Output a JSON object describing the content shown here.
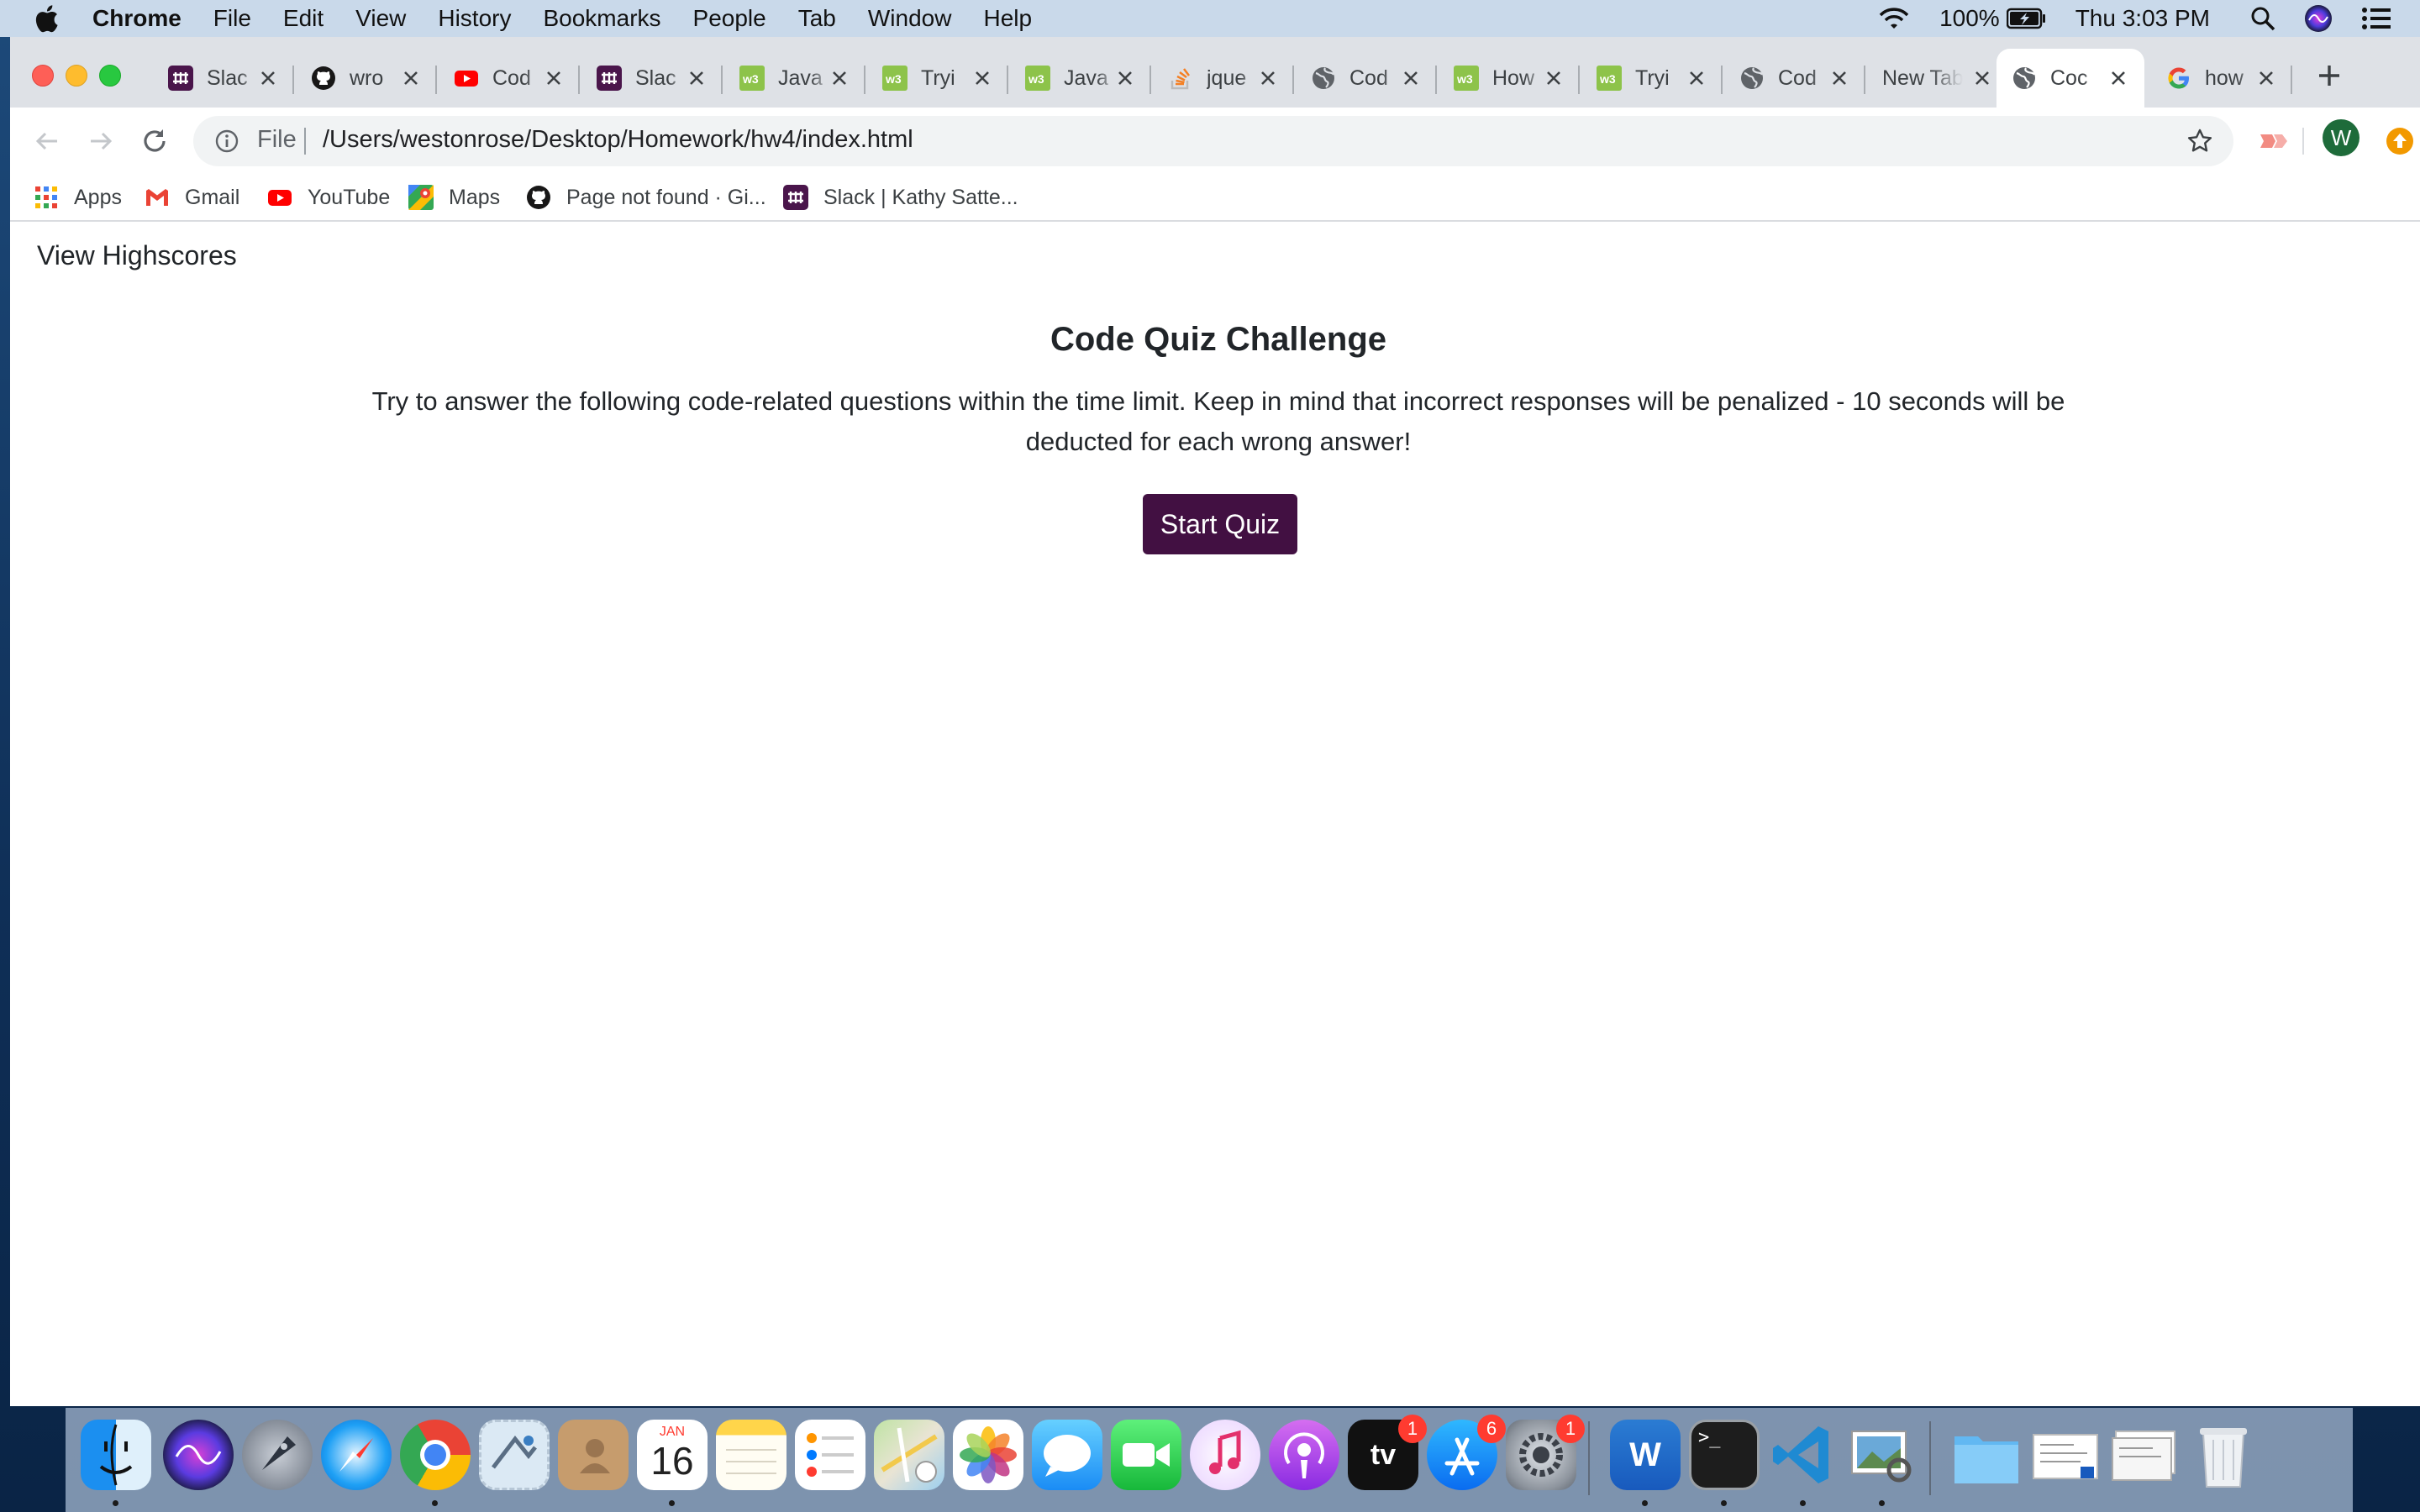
{
  "menubar": {
    "app_name": "Chrome",
    "menus": [
      "File",
      "Edit",
      "View",
      "History",
      "Bookmarks",
      "People",
      "Tab",
      "Window",
      "Help"
    ],
    "battery": "100%",
    "clock": "Thu 3:03 PM"
  },
  "tabs": [
    {
      "title": "Slac",
      "icon": "slack-icon"
    },
    {
      "title": "wro",
      "icon": "github-icon"
    },
    {
      "title": "Cod",
      "icon": "youtube-icon"
    },
    {
      "title": "Slac",
      "icon": "slack-icon"
    },
    {
      "title": "Java",
      "icon": "w3schools-icon"
    },
    {
      "title": "Tryi",
      "icon": "w3schools-icon"
    },
    {
      "title": "Java",
      "icon": "w3schools-icon"
    },
    {
      "title": "jque",
      "icon": "stackoverflow-icon"
    },
    {
      "title": "Cod",
      "icon": "globe-icon"
    },
    {
      "title": "How",
      "icon": "w3schools-icon"
    },
    {
      "title": "Tryi",
      "icon": "w3schools-icon"
    },
    {
      "title": "Cod",
      "icon": "globe-icon"
    },
    {
      "title": "New Tab",
      "icon": ""
    },
    {
      "title": "Coc",
      "icon": "globe-icon",
      "active": true
    },
    {
      "title": "how",
      "icon": "google-icon"
    }
  ],
  "omnibox": {
    "scheme": "File",
    "url": "/Users/westonrose/Desktop/Homework/hw4/index.html"
  },
  "profile_initial": "W",
  "bookmarks": [
    {
      "label": "Apps",
      "icon": "apps-grid-icon"
    },
    {
      "label": "Gmail",
      "icon": "gmail-icon"
    },
    {
      "label": "YouTube",
      "icon": "youtube-icon"
    },
    {
      "label": "Maps",
      "icon": "maps-icon"
    },
    {
      "label": "Page not found · Gi...",
      "icon": "github-icon"
    },
    {
      "label": "Slack | Kathy Satte...",
      "icon": "slack-icon"
    }
  ],
  "page": {
    "nav_link": "View Highscores",
    "title": "Code Quiz Challenge",
    "description": "Try to answer the following code-related questions within the time limit. Keep in mind that incorrect responses will be penalized - 10 seconds will be deducted for each wrong answer!",
    "start_button": "Start Quiz"
  },
  "dock": {
    "calendar_month": "JAN",
    "calendar_day": "16",
    "appletv_label": "tv",
    "badges": {
      "appletv": "1",
      "appstore": "6",
      "settings": "1"
    },
    "word_letter": "W",
    "terminal_prompt": ">_"
  },
  "colors": {
    "start_button_bg": "#421042",
    "tab_strip_bg": "#dee1e6",
    "menubar_bg": "#c9d9ea"
  }
}
